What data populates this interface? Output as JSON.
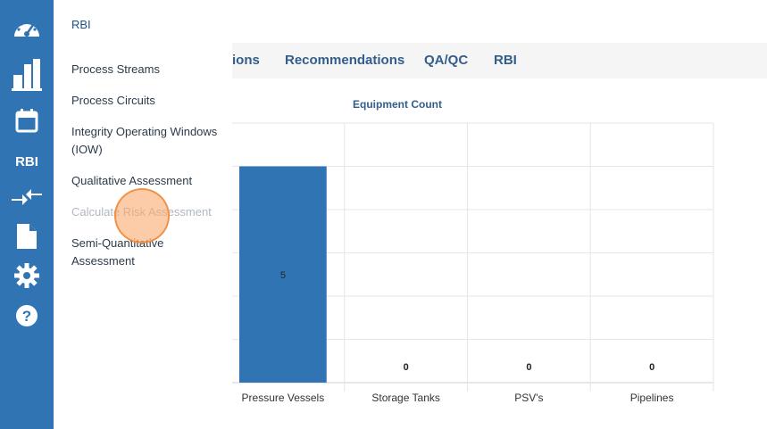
{
  "sidebar": {
    "items": [
      {
        "icon": "dashboard-gauge-icon"
      },
      {
        "icon": "plant-facility-icon"
      },
      {
        "icon": "calendar-icon"
      },
      {
        "label": "RBI"
      },
      {
        "icon": "compress-arrows-icon"
      },
      {
        "icon": "document-icon"
      },
      {
        "icon": "gear-icon"
      },
      {
        "icon": "help-icon"
      }
    ]
  },
  "flyout": {
    "title": "RBI",
    "items": [
      {
        "label": "Process Streams"
      },
      {
        "label": "Process Circuits"
      },
      {
        "label": "Integrity Operating Windows (IOW)"
      },
      {
        "label": "Qualitative Assessment"
      },
      {
        "label": "Calculate Risk Assessment"
      },
      {
        "label": "Semi-Quantitative Assessment"
      }
    ]
  },
  "tabs": [
    {
      "label": "ions"
    },
    {
      "label": "Recommendations"
    },
    {
      "label": "QA/QC"
    },
    {
      "label": "RBI"
    }
  ],
  "chart_data": {
    "type": "bar",
    "title": "Equipment Count",
    "categories": [
      "Pressure Vessels",
      "Storage Tanks",
      "PSV's",
      "Pipelines"
    ],
    "values": [
      5,
      0,
      0,
      0
    ],
    "value_labels": [
      "5",
      "0",
      "0",
      "0"
    ],
    "ylim": [
      0,
      6
    ],
    "grid": true,
    "bar_color": "#3174b4"
  },
  "colors": {
    "sidebar": "#3174b4",
    "tab_text": "#335d8a"
  }
}
